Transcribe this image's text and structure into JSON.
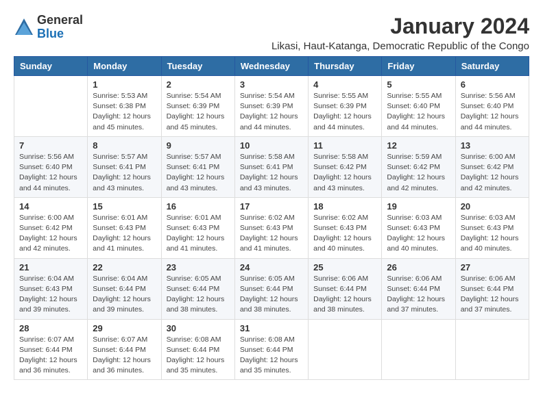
{
  "logo": {
    "general": "General",
    "blue": "Blue"
  },
  "header": {
    "month": "January 2024",
    "location": "Likasi, Haut-Katanga, Democratic Republic of the Congo"
  },
  "weekdays": [
    "Sunday",
    "Monday",
    "Tuesday",
    "Wednesday",
    "Thursday",
    "Friday",
    "Saturday"
  ],
  "weeks": [
    [
      {
        "day": "",
        "info": ""
      },
      {
        "day": "1",
        "info": "Sunrise: 5:53 AM\nSunset: 6:38 PM\nDaylight: 12 hours\nand 45 minutes."
      },
      {
        "day": "2",
        "info": "Sunrise: 5:54 AM\nSunset: 6:39 PM\nDaylight: 12 hours\nand 45 minutes."
      },
      {
        "day": "3",
        "info": "Sunrise: 5:54 AM\nSunset: 6:39 PM\nDaylight: 12 hours\nand 44 minutes."
      },
      {
        "day": "4",
        "info": "Sunrise: 5:55 AM\nSunset: 6:39 PM\nDaylight: 12 hours\nand 44 minutes."
      },
      {
        "day": "5",
        "info": "Sunrise: 5:55 AM\nSunset: 6:40 PM\nDaylight: 12 hours\nand 44 minutes."
      },
      {
        "day": "6",
        "info": "Sunrise: 5:56 AM\nSunset: 6:40 PM\nDaylight: 12 hours\nand 44 minutes."
      }
    ],
    [
      {
        "day": "7",
        "info": "Sunrise: 5:56 AM\nSunset: 6:40 PM\nDaylight: 12 hours\nand 44 minutes."
      },
      {
        "day": "8",
        "info": "Sunrise: 5:57 AM\nSunset: 6:41 PM\nDaylight: 12 hours\nand 43 minutes."
      },
      {
        "day": "9",
        "info": "Sunrise: 5:57 AM\nSunset: 6:41 PM\nDaylight: 12 hours\nand 43 minutes."
      },
      {
        "day": "10",
        "info": "Sunrise: 5:58 AM\nSunset: 6:41 PM\nDaylight: 12 hours\nand 43 minutes."
      },
      {
        "day": "11",
        "info": "Sunrise: 5:58 AM\nSunset: 6:42 PM\nDaylight: 12 hours\nand 43 minutes."
      },
      {
        "day": "12",
        "info": "Sunrise: 5:59 AM\nSunset: 6:42 PM\nDaylight: 12 hours\nand 42 minutes."
      },
      {
        "day": "13",
        "info": "Sunrise: 6:00 AM\nSunset: 6:42 PM\nDaylight: 12 hours\nand 42 minutes."
      }
    ],
    [
      {
        "day": "14",
        "info": "Sunrise: 6:00 AM\nSunset: 6:42 PM\nDaylight: 12 hours\nand 42 minutes."
      },
      {
        "day": "15",
        "info": "Sunrise: 6:01 AM\nSunset: 6:43 PM\nDaylight: 12 hours\nand 41 minutes."
      },
      {
        "day": "16",
        "info": "Sunrise: 6:01 AM\nSunset: 6:43 PM\nDaylight: 12 hours\nand 41 minutes."
      },
      {
        "day": "17",
        "info": "Sunrise: 6:02 AM\nSunset: 6:43 PM\nDaylight: 12 hours\nand 41 minutes."
      },
      {
        "day": "18",
        "info": "Sunrise: 6:02 AM\nSunset: 6:43 PM\nDaylight: 12 hours\nand 40 minutes."
      },
      {
        "day": "19",
        "info": "Sunrise: 6:03 AM\nSunset: 6:43 PM\nDaylight: 12 hours\nand 40 minutes."
      },
      {
        "day": "20",
        "info": "Sunrise: 6:03 AM\nSunset: 6:43 PM\nDaylight: 12 hours\nand 40 minutes."
      }
    ],
    [
      {
        "day": "21",
        "info": "Sunrise: 6:04 AM\nSunset: 6:43 PM\nDaylight: 12 hours\nand 39 minutes."
      },
      {
        "day": "22",
        "info": "Sunrise: 6:04 AM\nSunset: 6:44 PM\nDaylight: 12 hours\nand 39 minutes."
      },
      {
        "day": "23",
        "info": "Sunrise: 6:05 AM\nSunset: 6:44 PM\nDaylight: 12 hours\nand 38 minutes."
      },
      {
        "day": "24",
        "info": "Sunrise: 6:05 AM\nSunset: 6:44 PM\nDaylight: 12 hours\nand 38 minutes."
      },
      {
        "day": "25",
        "info": "Sunrise: 6:06 AM\nSunset: 6:44 PM\nDaylight: 12 hours\nand 38 minutes."
      },
      {
        "day": "26",
        "info": "Sunrise: 6:06 AM\nSunset: 6:44 PM\nDaylight: 12 hours\nand 37 minutes."
      },
      {
        "day": "27",
        "info": "Sunrise: 6:06 AM\nSunset: 6:44 PM\nDaylight: 12 hours\nand 37 minutes."
      }
    ],
    [
      {
        "day": "28",
        "info": "Sunrise: 6:07 AM\nSunset: 6:44 PM\nDaylight: 12 hours\nand 36 minutes."
      },
      {
        "day": "29",
        "info": "Sunrise: 6:07 AM\nSunset: 6:44 PM\nDaylight: 12 hours\nand 36 minutes."
      },
      {
        "day": "30",
        "info": "Sunrise: 6:08 AM\nSunset: 6:44 PM\nDaylight: 12 hours\nand 35 minutes."
      },
      {
        "day": "31",
        "info": "Sunrise: 6:08 AM\nSunset: 6:44 PM\nDaylight: 12 hours\nand 35 minutes."
      },
      {
        "day": "",
        "info": ""
      },
      {
        "day": "",
        "info": ""
      },
      {
        "day": "",
        "info": ""
      }
    ]
  ]
}
